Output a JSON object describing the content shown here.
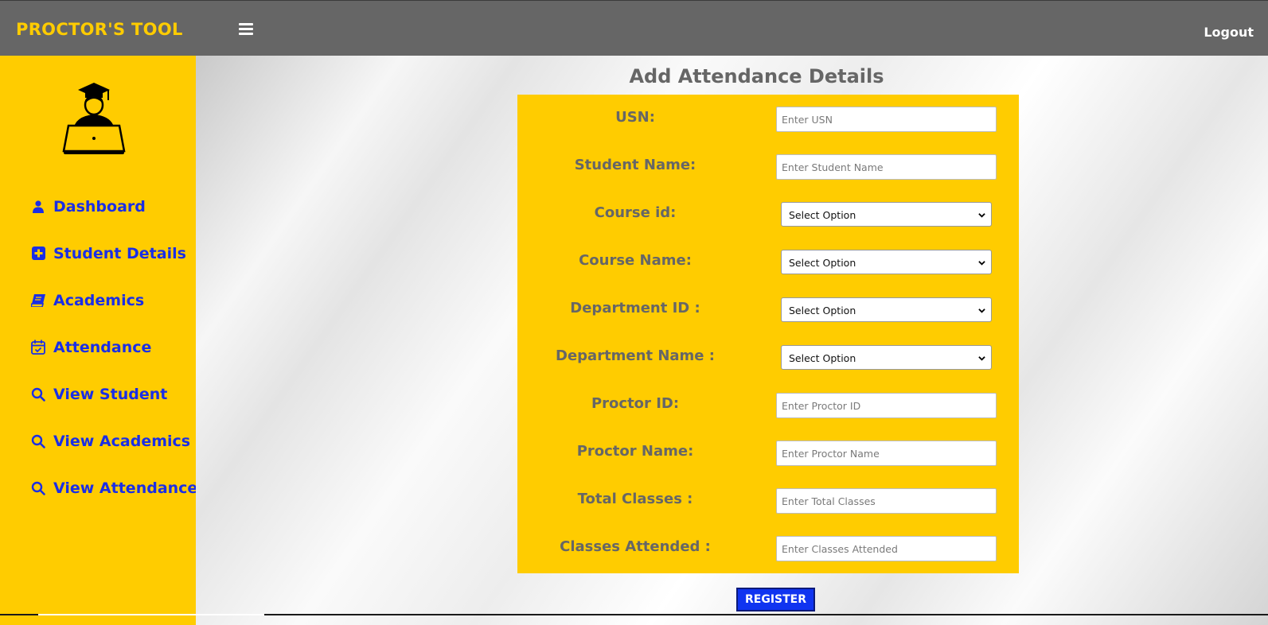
{
  "header": {
    "brand": "PROCTOR'S TOOL",
    "logout_label": "Logout"
  },
  "sidebar": {
    "items": [
      {
        "label": "Dashboard",
        "icon": "user-icon"
      },
      {
        "label": "Student Details",
        "icon": "plus-square-icon"
      },
      {
        "label": "Academics",
        "icon": "book-icon"
      },
      {
        "label": "Attendance",
        "icon": "calendar-check-icon"
      },
      {
        "label": "View Student",
        "icon": "search-icon"
      },
      {
        "label": "View Academics",
        "icon": "search-icon"
      },
      {
        "label": "View Attendance",
        "icon": "search-icon"
      }
    ]
  },
  "form": {
    "title": "Add Attendance Details",
    "fields": [
      {
        "label": "USN:",
        "type": "text",
        "placeholder": "Enter USN"
      },
      {
        "label": "Student Name:",
        "type": "text",
        "placeholder": "Enter Student Name"
      },
      {
        "label": "Course id:",
        "type": "select",
        "value": "Select Option"
      },
      {
        "label": "Course Name:",
        "type": "select",
        "value": "Select Option"
      },
      {
        "label": "Department ID :",
        "type": "select",
        "value": "Select Option"
      },
      {
        "label": "Department Name :",
        "type": "select",
        "value": "Select Option"
      },
      {
        "label": "Proctor ID:",
        "type": "text",
        "placeholder": "Enter Proctor ID"
      },
      {
        "label": "Proctor Name:",
        "type": "text",
        "placeholder": "Enter Proctor Name"
      },
      {
        "label": "Total Classes :",
        "type": "text",
        "placeholder": "Enter Total Classes"
      },
      {
        "label": "Classes Attended :",
        "type": "text",
        "placeholder": "Enter Classes Attended"
      }
    ],
    "submit_label": "REGISTER"
  },
  "colors": {
    "accent_yellow": "#ffcc00",
    "header_gray": "#666666",
    "link_blue": "#1a2ee6",
    "button_blue": "#1034f0"
  }
}
